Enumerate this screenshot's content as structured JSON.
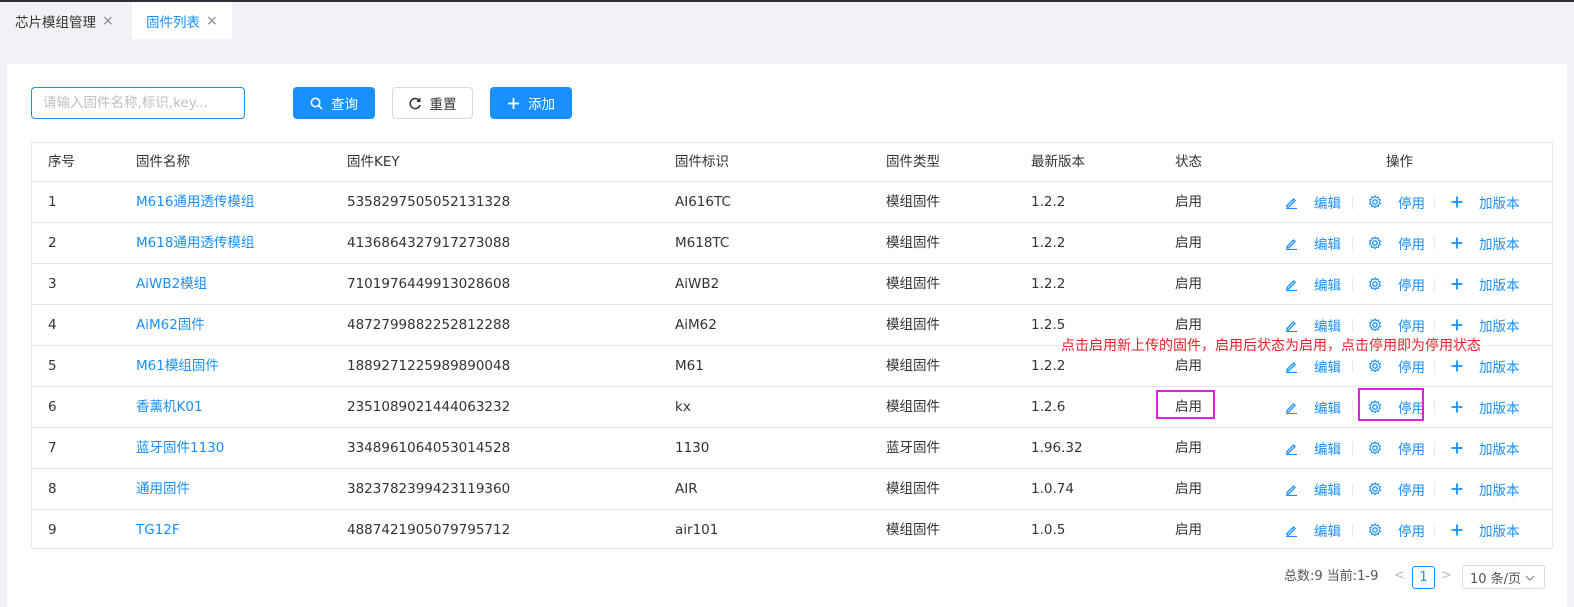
{
  "tabs": [
    {
      "label": "芯片模组管理",
      "close": "×"
    },
    {
      "label": "固件列表",
      "close": "×"
    }
  ],
  "search": {
    "placeholder": "请输入固件名称,标识,key..."
  },
  "buttons": {
    "query": "查询",
    "reset": "重置",
    "add": "添加"
  },
  "table": {
    "columns": [
      "序号",
      "固件名称",
      "固件KEY",
      "固件标识",
      "固件类型",
      "最新版本",
      "状态",
      "操作"
    ],
    "rows": [
      {
        "no": "1",
        "name": "M616通用透传模组",
        "key": "5358297505052131328",
        "ident": "AI616TC",
        "type": "模组固件",
        "version": "1.2.2",
        "status": "启用"
      },
      {
        "no": "2",
        "name": "M618通用透传模组",
        "key": "4136864327917273088",
        "ident": "M618TC",
        "type": "模组固件",
        "version": "1.2.2",
        "status": "启用"
      },
      {
        "no": "3",
        "name": "AiWB2模组",
        "key": "7101976449913028608",
        "ident": "AiWB2",
        "type": "模组固件",
        "version": "1.2.2",
        "status": "启用"
      },
      {
        "no": "4",
        "name": "AiM62固件",
        "key": "4872799882252812288",
        "ident": "AiM62",
        "type": "模组固件",
        "version": "1.2.5",
        "status": "启用"
      },
      {
        "no": "5",
        "name": "M61模组固件",
        "key": "1889271225989890048",
        "ident": "M61",
        "type": "模组固件",
        "version": "1.2.2",
        "status": "启用"
      },
      {
        "no": "6",
        "name": "香薰机K01",
        "key": "2351089021444063232",
        "ident": "kx",
        "type": "模组固件",
        "version": "1.2.6",
        "status": "启用"
      },
      {
        "no": "7",
        "name": "蓝牙固件1130",
        "key": "3348961064053014528",
        "ident": "1130",
        "type": "蓝牙固件",
        "version": "1.96.32",
        "status": "启用"
      },
      {
        "no": "8",
        "name": "通用固件",
        "key": "3823782399423119360",
        "ident": "AIR",
        "type": "模组固件",
        "version": "1.0.74",
        "status": "启用"
      },
      {
        "no": "9",
        "name": "TG12F",
        "key": "4887421905079795712",
        "ident": "air101",
        "type": "模组固件",
        "version": "1.0.5",
        "status": "启用"
      }
    ],
    "actions": {
      "edit": "编辑",
      "disable": "停用",
      "add_version": "加版本"
    }
  },
  "annotation": "点击启用新上传的固件，启用后状态为启用，点击停用即为停用状态",
  "pagination": {
    "total": "总数:9 当前:1-9",
    "prev": "<",
    "page": "1",
    "next": ">",
    "page_size": "10 条/页"
  },
  "colors": {
    "primary": "#1890ff",
    "highlight": "#e11ee1",
    "annotation": "#e8202a"
  }
}
